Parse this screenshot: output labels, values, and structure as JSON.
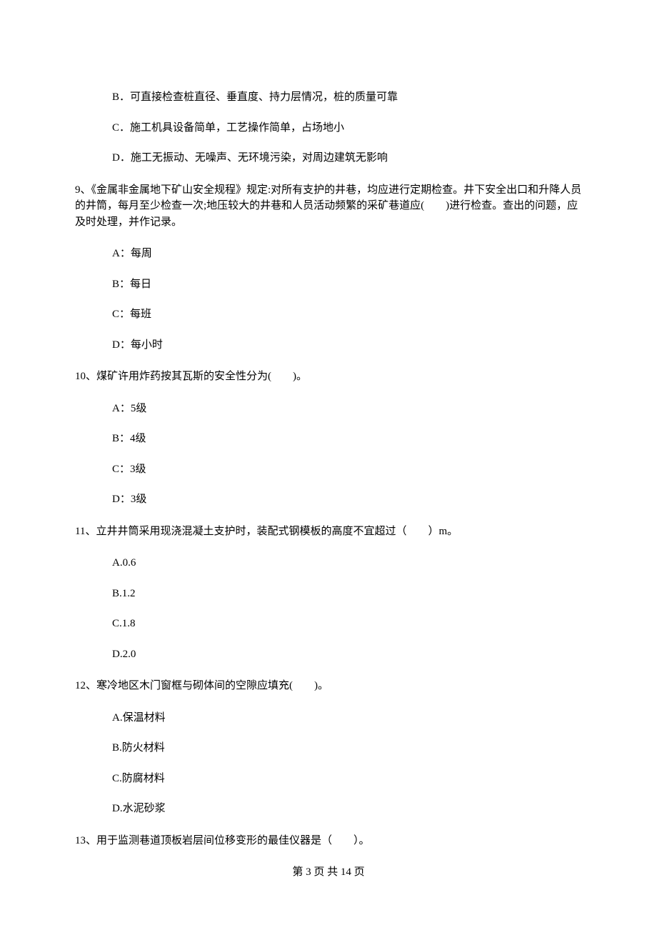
{
  "leadOptions": {
    "b": "B．可直接检查桩直径、垂直度、持力层情况，桩的质量可靠",
    "c": "C．施工机具设备简单，工艺操作简单，占场地小",
    "d": "D．施工无振动、无噪声、无环境污染，对周边建筑无影响"
  },
  "q9": {
    "text": "9、《金属非金属地下矿山安全规程》规定:对所有支护的井巷，均应进行定期检查。井下安全出口和升降人员的井筒，每月至少检查一次;地压较大的井巷和人员活动频繁的采矿巷道应(　　)进行检查。查出的问题，应及时处理，并作记录。",
    "a": "A：每周",
    "b": "B：每日",
    "c": "C：每班",
    "d": "D：每小时"
  },
  "q10": {
    "text": "10、煤矿许用炸药按其瓦斯的安全性分为(　　)。",
    "a": "A：5级",
    "b": "B：4级",
    "c": "C：3级",
    "d": "D：3级"
  },
  "q11": {
    "text": "11、立井井筒采用现浇混凝土支护时，装配式钢模板的高度不宜超过（　　）m。",
    "a": "A.0.6",
    "b": "B.1.2",
    "c": "C.1.8",
    "d": "D.2.0"
  },
  "q12": {
    "text": "12、寒冷地区木门窗框与砌体间的空隙应填充(　　)。",
    "a": "A.保温材料",
    "b": "B.防火材料",
    "c": "C.防腐材料",
    "d": "D.水泥砂浆"
  },
  "q13": {
    "text": "13、用于监测巷道顶板岩层间位移变形的最佳仪器是（　　）。"
  },
  "footer": "第 3 页 共 14 页"
}
